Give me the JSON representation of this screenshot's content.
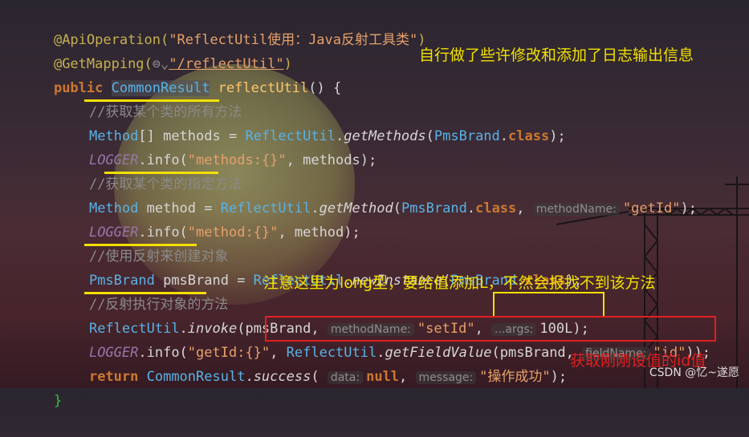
{
  "code": {
    "l1": {
      "pre": "@ApiOperation(",
      "str": "\"ReflectUtil使用：Java反射工具类\"",
      "post": ")"
    },
    "l2": {
      "pre": "@GetMapping(",
      "icon": "⊜⌄",
      "str": "\"/reflectUtil\"",
      "post": ")"
    },
    "l3": {
      "kw": "public ",
      "cls": "CommonResult",
      "fn": " reflectUtil",
      "post": "() {"
    },
    "l4": {
      "cm": "//获取某个类的所有方法"
    },
    "l5": {
      "cls": "Method",
      "a": "[] methods = ",
      "cls2": "ReflectUtil",
      "b": ".",
      "m": "getMethods",
      "c": "(",
      "cls3": "PmsBrand",
      "d": ".",
      "kw": "class",
      "e": ");"
    },
    "l6": {
      "const": "LOGGER",
      "a": ".info(",
      "str": "\"methods:{}\"",
      "b": ", methods);"
    },
    "l7": {
      "cm": "//获取某个类的指定方法"
    },
    "l8": {
      "cls": "Method",
      "a": " method = ",
      "cls2": "ReflectUtil",
      "b": ".",
      "m": "getMethod",
      "c": "(",
      "cls3": "PmsBrand",
      "d": ".",
      "kw": "class",
      "e": ", ",
      "hint": "methodName:",
      "str": "\"getId\"",
      "f": ");"
    },
    "l9": {
      "const": "LOGGER",
      "a": ".info(",
      "str": "\"method:{}\"",
      "b": ", method);"
    },
    "l10": {
      "cm": "//使用反射来创建对象"
    },
    "l11": {
      "cls": "PmsBrand",
      "a": " pmsBrand = ",
      "cls2": "ReflectUtil",
      "b": ".",
      "m": "newInstance",
      "c": "(",
      "cls3": "PmsBrand",
      "d": ".",
      "kw": "class",
      "e": ");"
    },
    "l12": {
      "cm": "//反射执行对象的方法"
    },
    "l13": {
      "cls": "ReflectUtil",
      "b": ".",
      "m": "invoke",
      "c": "(pmsBrand, ",
      "hint": "methodName:",
      "str": "\"setId\"",
      "d": ", ",
      "hint2": "...args:",
      "num": "100L",
      "e": ");"
    },
    "l14": {
      "const": "LOGGER",
      "a": ".info(",
      "str": "\"getId:{}\"",
      "b": ", ",
      "cls": "ReflectUtil",
      "c": ".",
      "m": "getFieldValue",
      "d": "(pmsBrand, ",
      "hint": "fieldName:",
      "str2": "\"id\"",
      "e": "));"
    },
    "l15": {
      "kw": "return ",
      "cls": "CommonResult",
      "b": ".",
      "m": "success",
      "c": "( ",
      "hint": "data:",
      "kw2": "null",
      "d": ", ",
      "hint2": "message:",
      "str": "\"操作成功\"",
      "e": ");"
    },
    "l16": {
      "brace": "}"
    }
  },
  "notes": {
    "top": "自行做了些许修改和添加了日志输出信息",
    "long": "注意这里为long型，要给值添加L，不然会报找不到该方法",
    "id": "获取刚刚设值的id值"
  },
  "watermark": "CSDN @忆~遂愿",
  "colors": {
    "highlight": "#f2e000",
    "red_box": "#e02020"
  }
}
